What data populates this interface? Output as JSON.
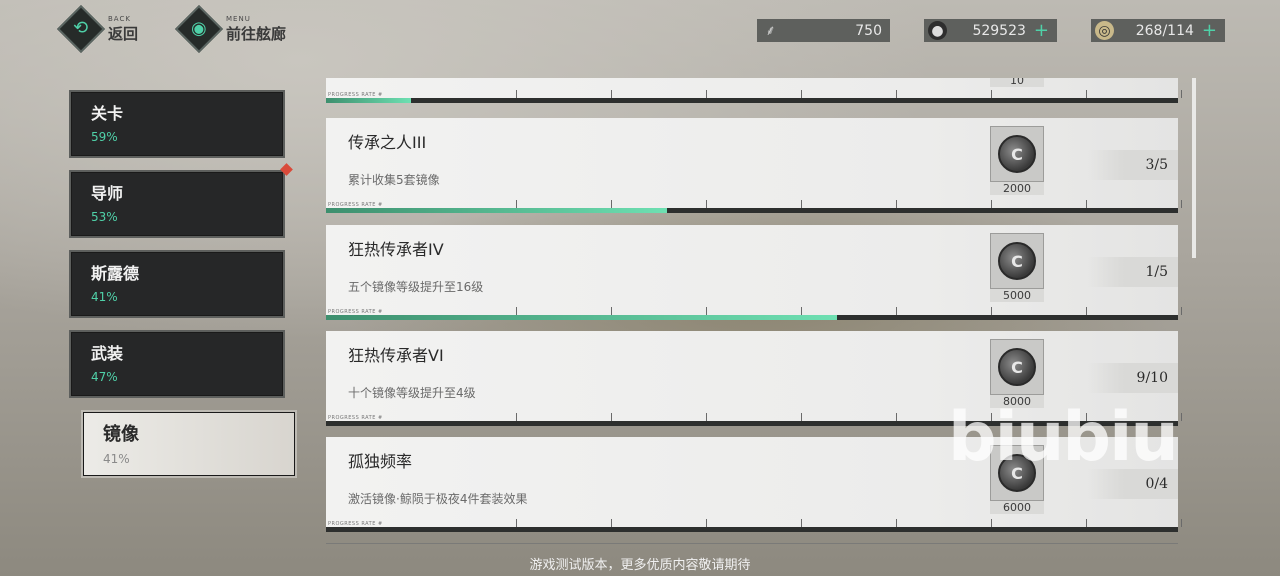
{
  "header": {
    "back": {
      "en": "BACK",
      "label": "返回",
      "icon": "back-icon"
    },
    "menu": {
      "en": "MENU",
      "label": "前往舷廊",
      "icon": "menu-icon"
    },
    "currencies": [
      {
        "icon": "feather-icon",
        "value": "750",
        "has_plus": false
      },
      {
        "icon": "coin-icon",
        "value": "529523",
        "has_plus": true
      },
      {
        "icon": "stamina-icon",
        "value": "268/114",
        "has_plus": true
      }
    ]
  },
  "sidebar": {
    "items": [
      {
        "label": "关卡",
        "percent": "59%"
      },
      {
        "label": "导师",
        "percent": "53%"
      },
      {
        "label": "斯露德",
        "percent": "41%"
      },
      {
        "label": "武装",
        "percent": "47%"
      },
      {
        "label": "镜像",
        "percent": "41%",
        "active": true
      }
    ]
  },
  "progress_label": "PROGRESS RATE #",
  "tasks": [
    {
      "title": "",
      "desc": "",
      "reward": "10",
      "counter": "",
      "progress": 0.1
    },
    {
      "title": "传承之人III",
      "desc": "累计收集5套镜像",
      "reward": "2000",
      "counter": "3/5",
      "progress": 0.4
    },
    {
      "title": "狂热传承者IV",
      "desc": "五个镜像等级提升至16级",
      "reward": "5000",
      "counter": "1/5",
      "progress": 0.6
    },
    {
      "title": "狂热传承者VI",
      "desc": "十个镜像等级提升至4级",
      "reward": "8000",
      "counter": "9/10",
      "progress": 0.0
    },
    {
      "title": "孤独频率",
      "desc": "激活镜像·鲸陨于极夜4件套装效果",
      "reward": "6000",
      "counter": "0/4",
      "progress": 0.0
    }
  ],
  "watermark": "biubiu",
  "footer": "游戏测试版本，更多优质内容敬请期待"
}
